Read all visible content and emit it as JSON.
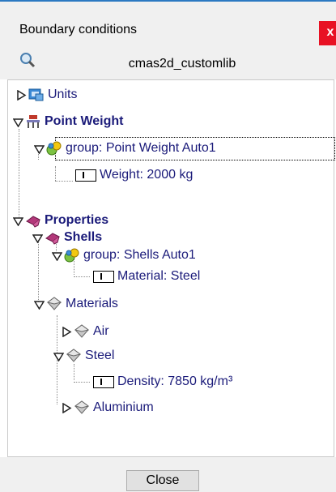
{
  "dialog": {
    "title": "Boundary conditions",
    "close_x": "x",
    "search_value": "cmas2d_customlib",
    "close_button": "Close"
  },
  "tree": {
    "units": "Units",
    "point_weight": "Point Weight",
    "pw_group": "group: Point Weight Auto1",
    "weight": "Weight: 2000 kg",
    "properties": "Properties",
    "shells": "Shells",
    "shells_group": "group: Shells Auto1",
    "material": "Material: Steel",
    "materials": "Materials",
    "air": "Air",
    "steel": "Steel",
    "density": "Density: 7850 kg/m³",
    "aluminium": "Aluminium"
  },
  "colors": {
    "accent": "#2b79c2",
    "close_red": "#e81123",
    "tree_text": "#1b1b7a"
  }
}
